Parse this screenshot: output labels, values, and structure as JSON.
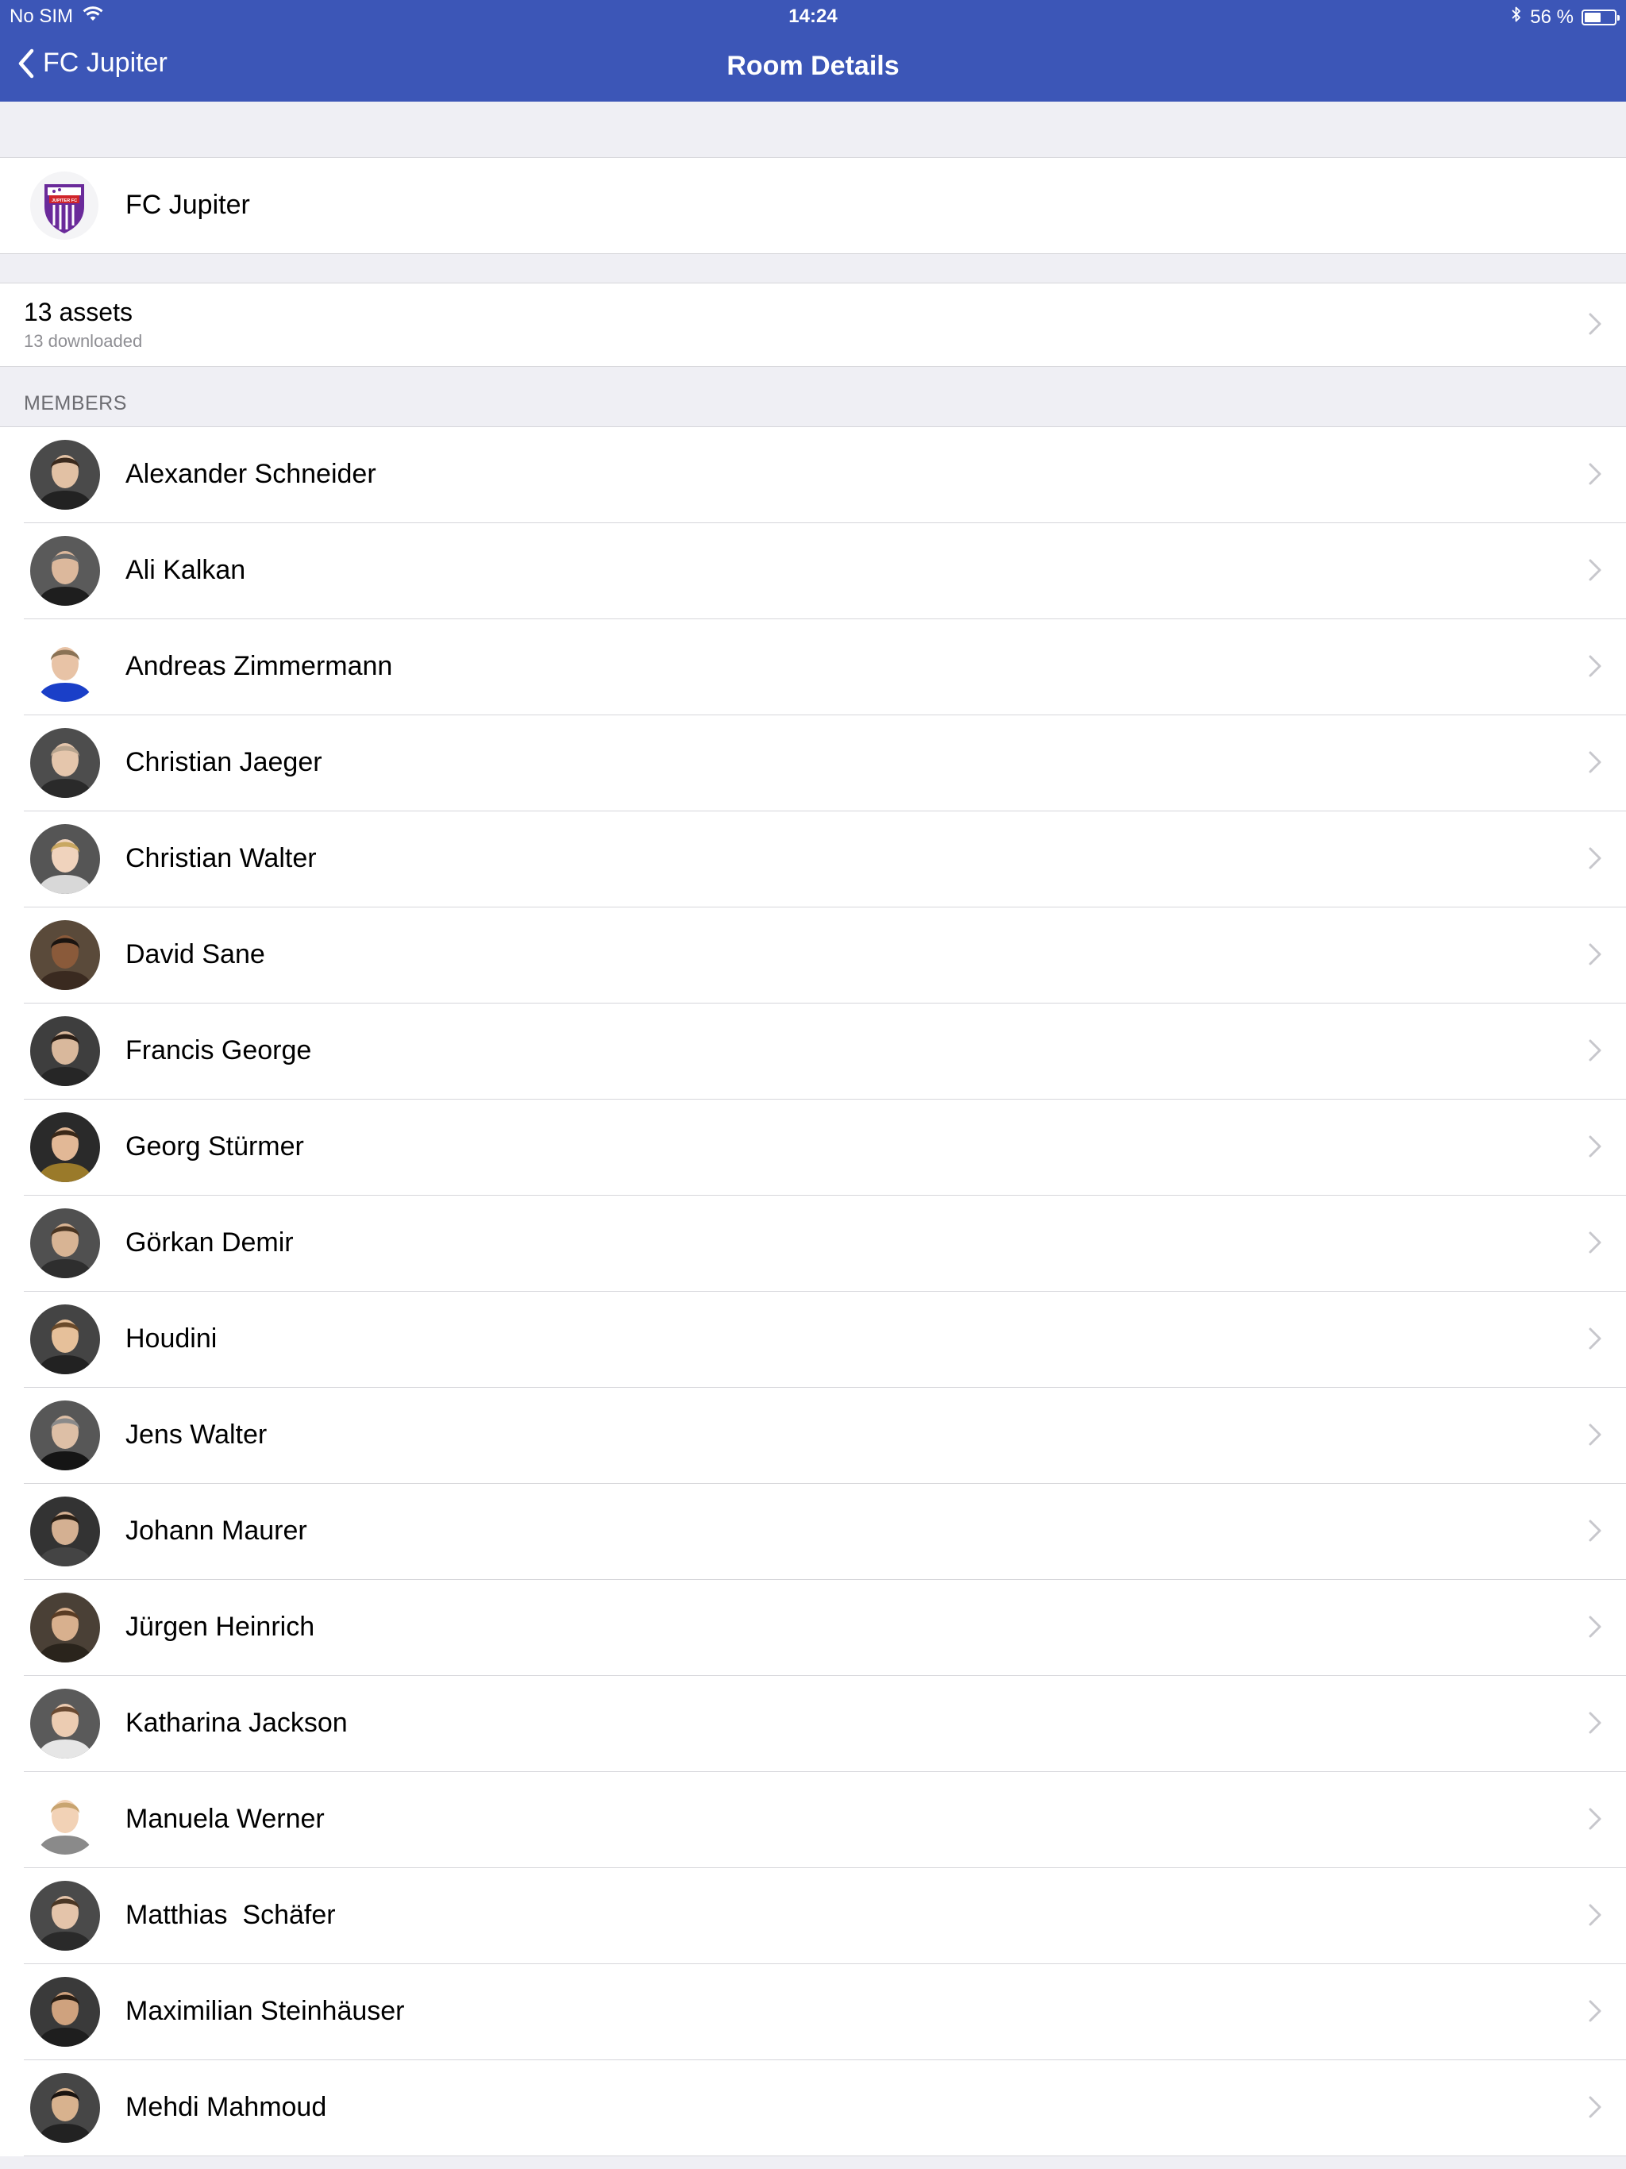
{
  "status_bar": {
    "carrier": "No SIM",
    "time": "14:24",
    "battery": "56 %",
    "battery_level": 0.56,
    "icons": [
      "wifi-icon",
      "bluetooth-icon",
      "battery-icon"
    ]
  },
  "nav": {
    "back_label": "FC Jupiter",
    "title": "Room Details"
  },
  "room": {
    "name": "FC Jupiter",
    "logo_text": "JUPITER FC"
  },
  "assets": {
    "count_label": "13 assets",
    "downloaded_label": "13 downloaded"
  },
  "members_header": "MEMBERS",
  "members": [
    {
      "name": "Alexander Schneider",
      "bg": "#4a4a4a",
      "skin": "#e2c1a4",
      "hair": "#3b2a1d",
      "shirt": "#222222"
    },
    {
      "name": "Ali Kalkan",
      "bg": "#5a5a5a",
      "skin": "#dcb89c",
      "hair": "#6a6a6a",
      "shirt": "#1e1e1e"
    },
    {
      "name": "Andreas Zimmermann",
      "bg": "#ffffff",
      "skin": "#e8c3a6",
      "hair": "#8a7255",
      "shirt": "#1a3fc8"
    },
    {
      "name": "Christian Jaeger",
      "bg": "#4d4d4d",
      "skin": "#e5c6ac",
      "hair": "#b8a48e",
      "shirt": "#2a2a2a"
    },
    {
      "name": "Christian Walter",
      "bg": "#555555",
      "skin": "#f0d3bd",
      "hair": "#c9a761",
      "shirt": "#d8d8d8"
    },
    {
      "name": "David Sane",
      "bg": "#5a4a3a",
      "skin": "#8a5a3a",
      "hair": "#1a1410",
      "shirt": "#3a2a20"
    },
    {
      "name": "Francis George",
      "bg": "#3e3e3e",
      "skin": "#d9b89c",
      "hair": "#2a1e16",
      "shirt": "#262626"
    },
    {
      "name": "Georg Stürmer",
      "bg": "#2a2a2a",
      "skin": "#e2b896",
      "hair": "#3a2818",
      "shirt": "#9a7a2a"
    },
    {
      "name": "Görkan Demir",
      "bg": "#505050",
      "skin": "#d8b494",
      "hair": "#4a3522",
      "shirt": "#2e2e2e"
    },
    {
      "name": "Houdini",
      "bg": "#444444",
      "skin": "#e6c09a",
      "hair": "#6a4a2a",
      "shirt": "#222222"
    },
    {
      "name": "Jens Walter",
      "bg": "#575757",
      "skin": "#ddbfa6",
      "hair": "#8a8a8a",
      "shirt": "#151515"
    },
    {
      "name": "Johann Maurer",
      "bg": "#333333",
      "skin": "#d4b092",
      "hair": "#2b2016",
      "shirt": "#444444"
    },
    {
      "name": "Jürgen Heinrich",
      "bg": "#4a4036",
      "skin": "#d8b08e",
      "hair": "#5a3c24",
      "shirt": "#2a241c"
    },
    {
      "name": "Katharina Jackson",
      "bg": "#5a5a5a",
      "skin": "#ecccb2",
      "hair": "#6a4a32",
      "shirt": "#e6e6e6"
    },
    {
      "name": "Manuela Werner",
      "bg": "#ffffff",
      "skin": "#f2d2b6",
      "hair": "#c8a470",
      "shirt": "#8a8a8a"
    },
    {
      "name": "Matthias  Schäfer",
      "bg": "#4a4a4a",
      "skin": "#e4c4aa",
      "hair": "#4a3624",
      "shirt": "#2a2a2a"
    },
    {
      "name": "Maximilian Steinhäuser",
      "bg": "#3a3a3a",
      "skin": "#cfa27e",
      "hair": "#2a1e14",
      "shirt": "#1e1e1e"
    },
    {
      "name": "Mehdi Mahmoud",
      "bg": "#464646",
      "skin": "#d8b28e",
      "hair": "#1a1410",
      "shirt": "#222222"
    }
  ],
  "colors": {
    "accent": "#3c56b7",
    "background": "#efeff4",
    "separator": "#d6d6da",
    "secondary_text": "#8e8e93",
    "chevron": "#c7c7cc"
  }
}
